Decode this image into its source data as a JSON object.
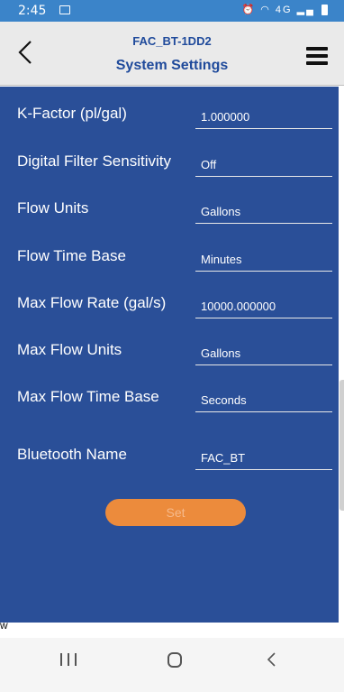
{
  "status_bar": {
    "time": "2:45",
    "network": "4G"
  },
  "header": {
    "device_name": "FAC_BT-1DD2",
    "title": "System Settings"
  },
  "settings": [
    {
      "label": "K-Factor (pl/gal)",
      "value": "1.000000"
    },
    {
      "label": "Digital Filter Sensitivity",
      "value": "Off"
    },
    {
      "label": "Flow Units",
      "value": "Gallons"
    },
    {
      "label": "Flow Time Base",
      "value": "Minutes"
    },
    {
      "label": "Max Flow Rate (gal/s)",
      "value": "10000.000000"
    },
    {
      "label": "Max Flow Units",
      "value": "Gallons"
    },
    {
      "label": "Max Flow Time Base",
      "value": "Seconds"
    },
    {
      "label": "Bluetooth Name",
      "value": "FAC_BT"
    }
  ],
  "set_button": {
    "label": "Set"
  },
  "side_text": "w",
  "colors": {
    "content_bg": "#2a4f98",
    "status_bar": "#3b84c9",
    "set_button": "#ec8b3c",
    "header_text": "#1f4a9b"
  },
  "icons": {
    "back": "chevron-left-icon",
    "menu": "hamburger-menu-icon"
  }
}
